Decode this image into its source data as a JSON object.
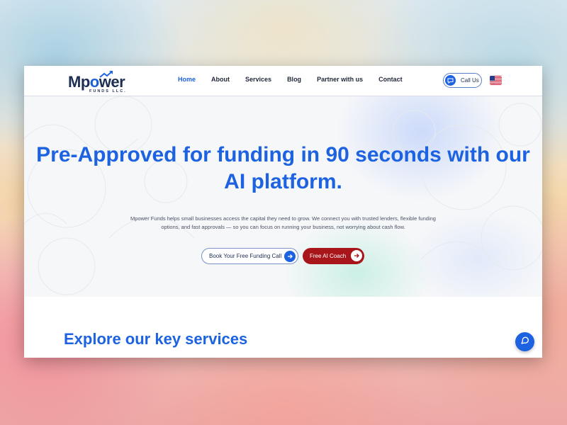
{
  "brand": {
    "name": "Mpower",
    "subtitle": "FUNDS LLC.",
    "colors": {
      "primary": "#1d62e0",
      "navy": "#1d2e52",
      "accent_red": "#a8161c"
    }
  },
  "nav": {
    "items": [
      {
        "label": "Home",
        "active": true
      },
      {
        "label": "About",
        "active": false
      },
      {
        "label": "Services",
        "active": false
      },
      {
        "label": "Blog",
        "active": false
      },
      {
        "label": "Partner with us",
        "active": false
      },
      {
        "label": "Contact",
        "active": false
      }
    ]
  },
  "header": {
    "call_label": "Call Us",
    "call_icon": "chat-bubble-icon",
    "language_flag": "us-flag-icon"
  },
  "hero": {
    "title": "Pre-Approved for funding in 90 seconds with our AI platform.",
    "description": "Mpower Funds helps small businesses access the capital they need to grow. We connect you with trusted lenders, flexible funding options, and fast approvals — so you can focus on running your business, not worrying about cash flow.",
    "primary_button": "Book Your Free Funding Call",
    "secondary_button": "Free AI Coach",
    "button_icon": "arrow-right-icon"
  },
  "services": {
    "title": "Explore our key services"
  },
  "floating_button": {
    "icon": "chat-assistant-icon"
  }
}
